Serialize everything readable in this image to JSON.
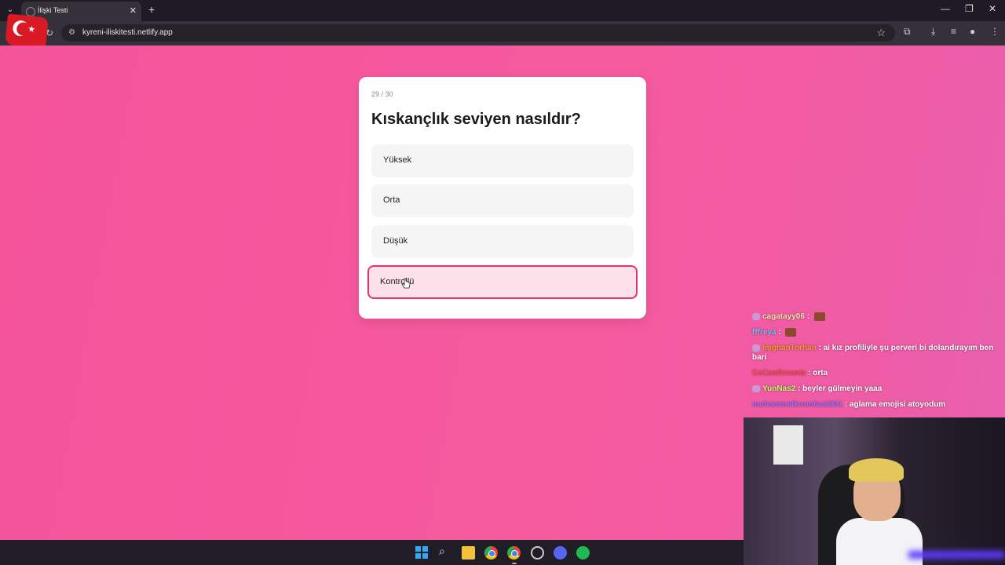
{
  "browser": {
    "tab_title": "İlişki Testi",
    "url": "kyreni-iliskitesti.netlify.app"
  },
  "quiz": {
    "progress": "29 / 30",
    "question": "Kıskançlık seviyen nasıldır?",
    "options": [
      "Yüksek",
      "Orta",
      "Düşük",
      "Kontrollü"
    ],
    "selected_index": 3
  },
  "chat": {
    "messages": [
      {
        "user": "cagatayy06",
        "text": ""
      },
      {
        "user": "fffreya",
        "text": ""
      },
      {
        "user": "ImghanTorhan",
        "text": "ai kız profiliyle şu perveri bi dolandırayım ben bari"
      },
      {
        "user": "CcCastlevania",
        "text": "orta"
      },
      {
        "user": "YunNas2",
        "text": "beyler gülmeyin yaaa"
      },
      {
        "user": "muhammetkrmnfan2301",
        "text": "aglama emojisi atoyodum"
      }
    ]
  },
  "colors": {
    "background": "#f5549b",
    "selected_border": "#e0336f",
    "selected_fill": "#fde0ea"
  }
}
